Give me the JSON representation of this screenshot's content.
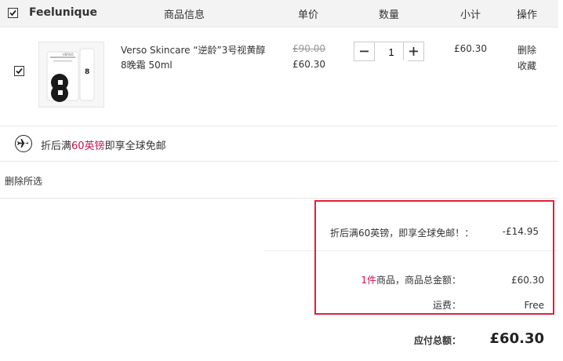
{
  "header": {
    "brand": "Feelunique",
    "col_product": "商品信息",
    "col_price": "单价",
    "col_qty": "数量",
    "col_subtotal": "小计",
    "col_action": "操作"
  },
  "item": {
    "checked": true,
    "name": "Verso Skincare “逆龄”3号视黄醇8晚霜 50ml",
    "original_price": "£90.00",
    "price": "£60.30",
    "quantity": "1",
    "subtotal": "£60.30",
    "delete_label": "删除",
    "favorite_label": "收藏",
    "image_brand": "VERSO",
    "image_number": "8"
  },
  "shipping": {
    "prefix": "折后满",
    "highlight": "60英镑",
    "suffix": "即享全球免邮"
  },
  "actions": {
    "delete_selected": "删除所选"
  },
  "summary": {
    "discount_label": "折后满60英镑，即享全球免邮！：",
    "discount_value": "-£14.95",
    "count": "1件",
    "goods_total_label": "商品，商品总金额：",
    "goods_total": "£60.30",
    "freight_label": "运费：",
    "freight_value": "Free",
    "payable_label": "应付总额：",
    "payable_value": "£60.30"
  },
  "colors": {
    "accent_red": "#c8124b",
    "highlight_border": "#e0203a"
  }
}
